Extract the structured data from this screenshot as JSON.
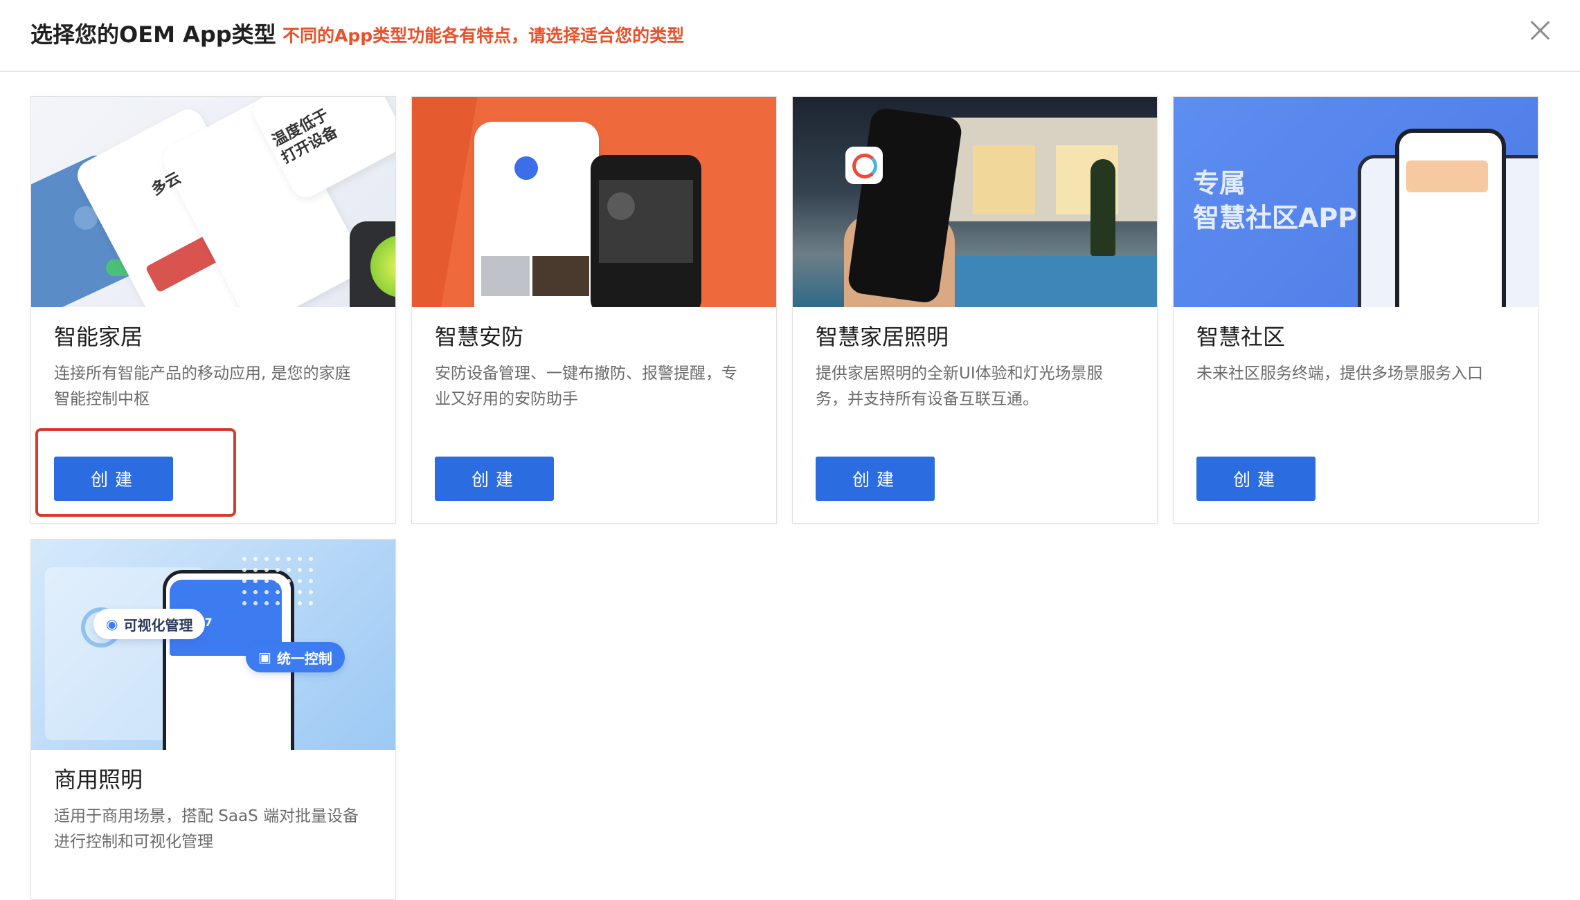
{
  "header": {
    "title": "选择您的OEM App类型",
    "hint": "不同的App类型功能各有特点，请选择适合您的类型",
    "close_icon": "close-icon"
  },
  "colors": {
    "primary_button": "#2b6de0",
    "hint_text": "#e8512a",
    "highlight_border": "#d93a2b"
  },
  "cards": [
    {
      "name": "智能家居",
      "description": "连接所有智能产品的移动应用, 是您的家庭智能控制中枢",
      "button_label": "创建",
      "banner_text": [
        "温度低于",
        "打开设备",
        "多云"
      ]
    },
    {
      "name": "智慧安防",
      "description": "安防设备管理、一键布撤防、报警提醒，专业又好用的安防助手",
      "button_label": "创建"
    },
    {
      "name": "智慧家居照明",
      "description": "提供家居照明的全新UI体验和灯光场景服务，并支持所有设备互联互通。",
      "button_label": "创建"
    },
    {
      "name": "智慧社区",
      "description": "未来社区服务终端，提供多场景服务入口",
      "button_label": "创建",
      "banner_text": [
        "专属",
        "智慧社区APP"
      ]
    },
    {
      "name": "商用照明",
      "description": "适用于商用场景，搭配 SaaS 端对批量设备进行控制和可视化管理",
      "banner_text": [
        "可视化管理",
        "统一控制",
        "12567"
      ]
    }
  ]
}
